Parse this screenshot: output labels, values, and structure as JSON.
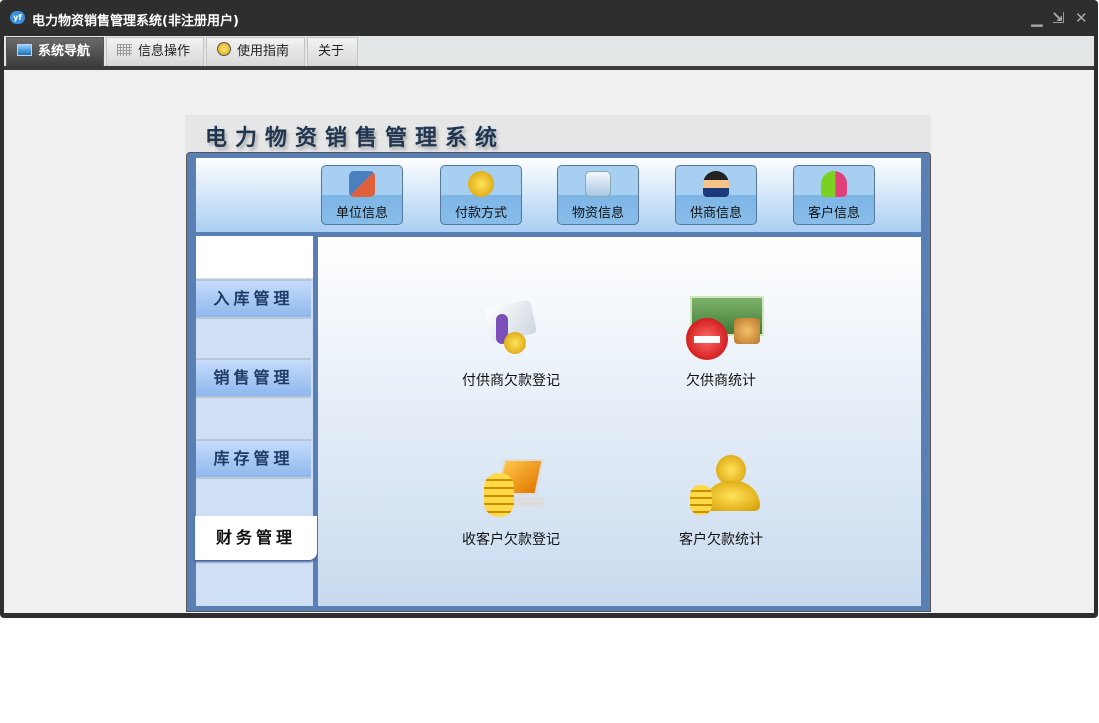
{
  "window": {
    "title": "电力物资销售管理系统(非注册用户)",
    "controls": [
      "minimize",
      "restore",
      "close"
    ]
  },
  "tabs": [
    {
      "label": "系统导航",
      "active": true
    },
    {
      "label": "信息操作"
    },
    {
      "label": "使用指南"
    },
    {
      "label": "关于"
    }
  ],
  "banner": "电力物资销售管理系统",
  "top_buttons": [
    {
      "label": "单位信息"
    },
    {
      "label": "付款方式"
    },
    {
      "label": "物资信息"
    },
    {
      "label": "供商信息"
    },
    {
      "label": "客户信息"
    }
  ],
  "sidebar": [
    {
      "label": "入库管理"
    },
    {
      "label": "销售管理"
    },
    {
      "label": "库存管理"
    },
    {
      "label": "财务管理",
      "active": true
    }
  ],
  "functions": [
    {
      "label": "付供商欠款登记"
    },
    {
      "label": "欠供商统计"
    },
    {
      "label": "收客户欠款登记"
    },
    {
      "label": "客户欠款统计"
    }
  ]
}
